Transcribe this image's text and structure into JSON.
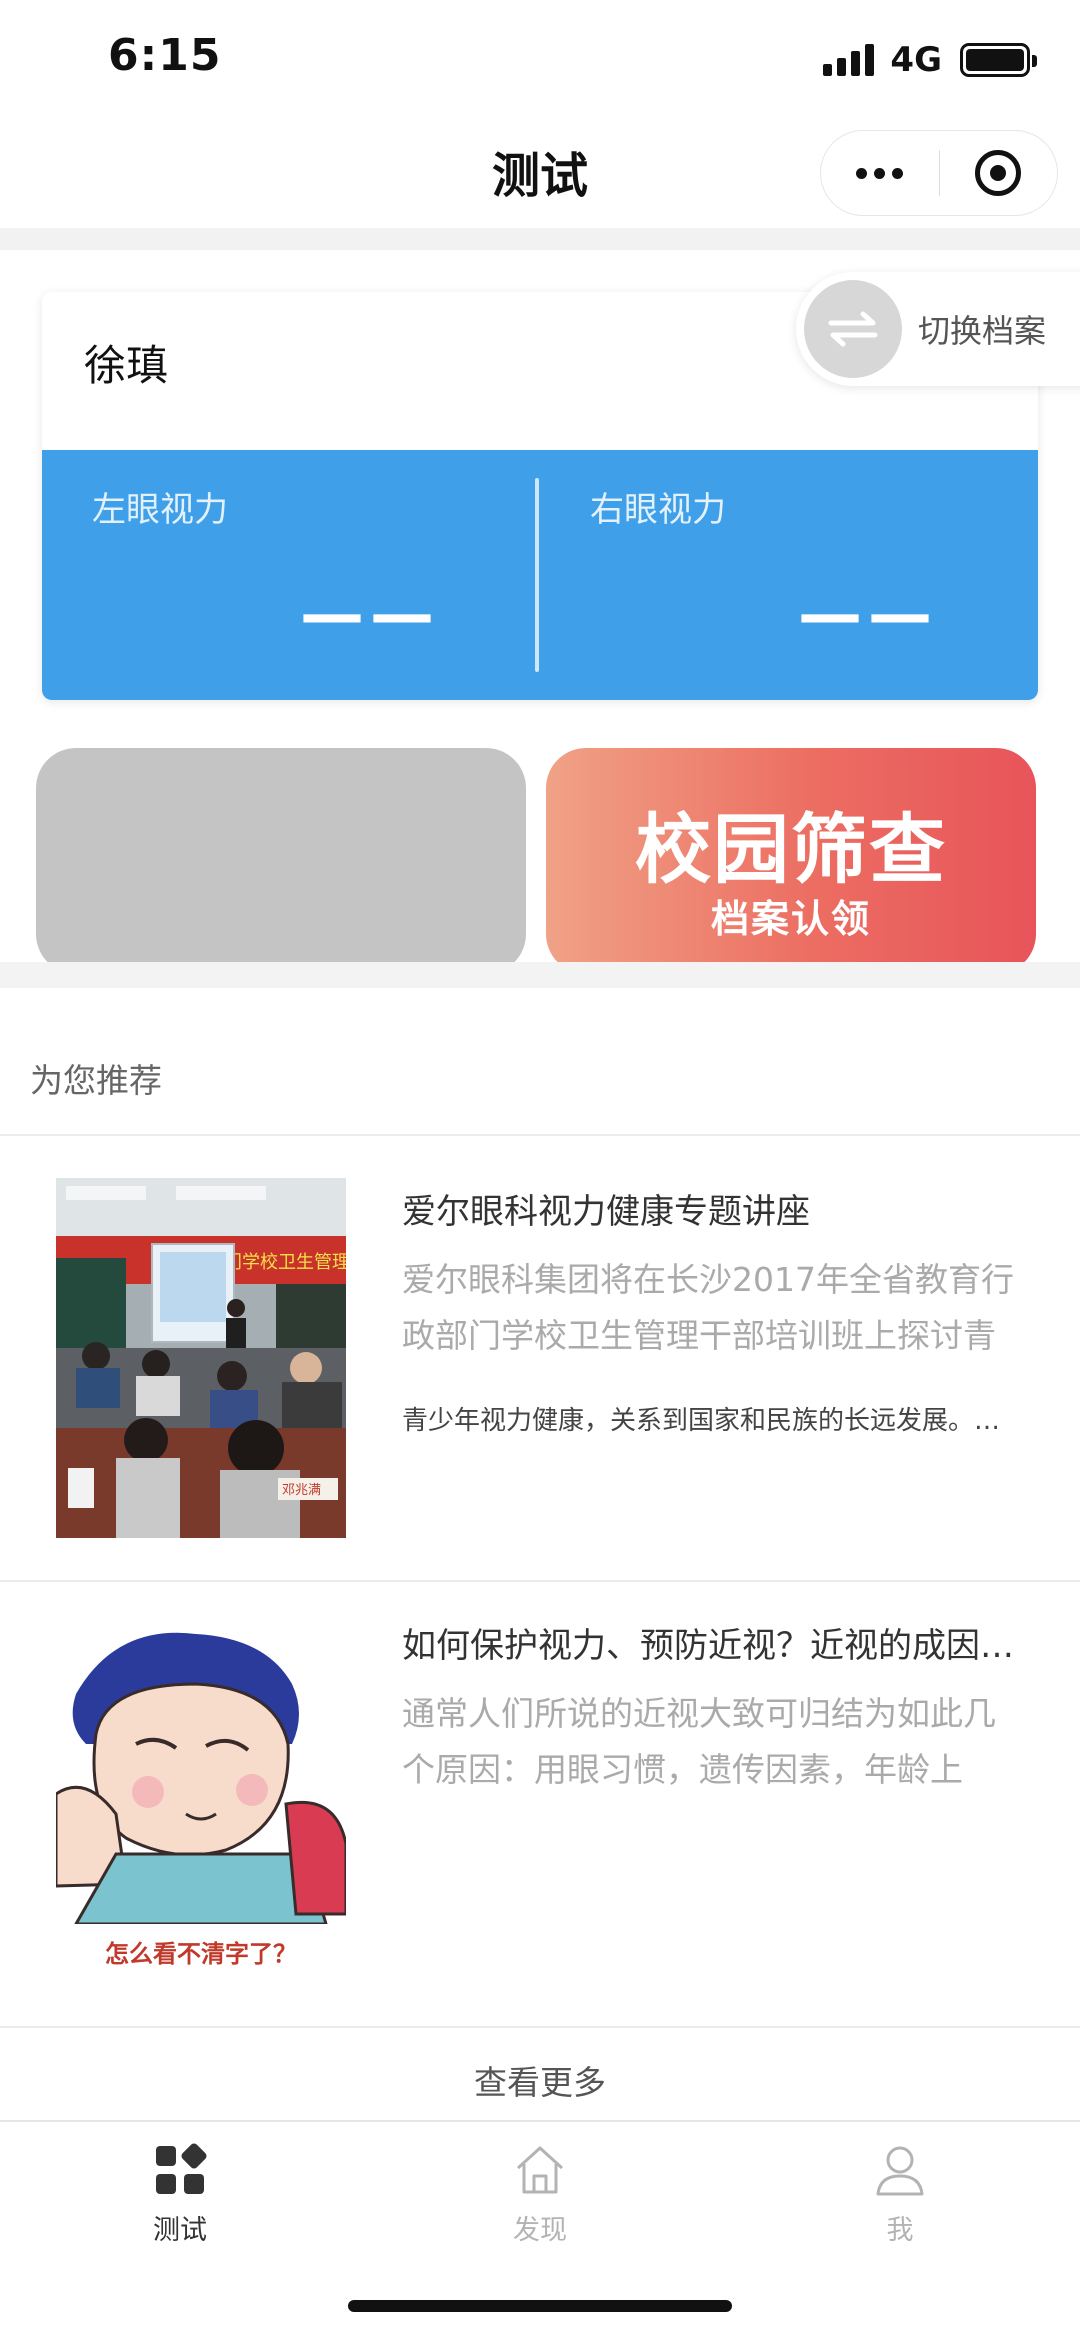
{
  "status": {
    "time": "6:15",
    "network": "4G"
  },
  "nav": {
    "title": "测试"
  },
  "profile": {
    "name": "徐瑱",
    "switch_label": "切换档案",
    "left_label": "左眼视力",
    "left_value": "——",
    "right_label": "右眼视力",
    "right_value": "——"
  },
  "screening": {
    "title": "校园筛查",
    "subtitle": "档案认领"
  },
  "recommend": {
    "title": "为您推荐",
    "articles": [
      {
        "title": "爱尔眼科视力健康专题讲座",
        "desc": "爱尔眼科集团将在长沙2017年全省教育行政部门学校卫生管理干部培训班上探讨青",
        "extra": "青少年视力健康，关系到国家和民族的长远发展。…",
        "thumb_text": "门学校卫生管理干部",
        "thumb_name_card": "邓兆满"
      },
      {
        "title": "如何保护视力、预防近视？近视的成因…",
        "desc": "通常人们所说的近视大致可归结为如此几个原因：用眼习惯，遗传因素，年龄上",
        "thumb_caption": "怎么看不清字了？"
      }
    ],
    "see_more": "查看更多"
  },
  "tabs": [
    {
      "label": "测试",
      "icon": "grid-icon",
      "active": true
    },
    {
      "label": "发现",
      "icon": "home-icon",
      "active": false
    },
    {
      "label": "我",
      "icon": "person-icon",
      "active": false
    }
  ],
  "colors": {
    "vision_panel": "#3f9fe8",
    "screening_gradient_start": "#f0a286",
    "screening_gradient_end": "#e8545a",
    "tab_active": "#333333",
    "tab_inactive": "#b3b3b3"
  }
}
